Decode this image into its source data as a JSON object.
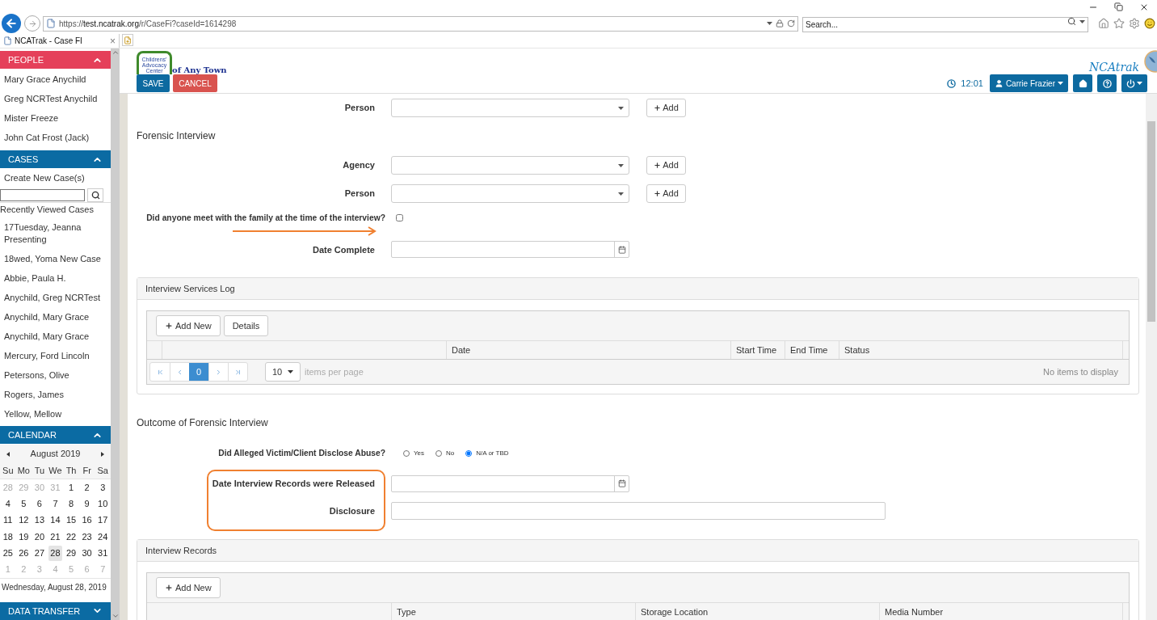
{
  "browser": {
    "url": {
      "scheme": "https://",
      "host": "test.ncatrak.org",
      "path": "/r/CaseFi?caseId=1614298"
    },
    "search": {
      "placeholder": "Search..."
    },
    "tabs": [
      {
        "title": "NCATrak - Case FI",
        "close": "×",
        "selected": true
      }
    ]
  },
  "sidebar": {
    "panels": [
      {
        "kind": "list",
        "title": "PEOPLE",
        "color": "#e5405a",
        "expanded": true,
        "items": [
          "Mary Grace Anychild",
          "Greg NCRTest Anychild",
          "Mister Freeze",
          "John Cat Frost (Jack)"
        ]
      },
      {
        "kind": "cases",
        "title": "CASES",
        "color": "#0b6ba3",
        "expanded": true,
        "create": "Create New Case(s)",
        "recent_title": "Recently Viewed Cases",
        "items": [
          "17Tuesday, Jeanna Presenting",
          "18wed, Yoma New Case",
          "Abbie, Paula H.",
          "Anychild, Greg NCRTest",
          "Anychild, Mary Grace",
          "Anychild, Mary Grace",
          "Mercury, Ford Lincoln",
          "Petersons, Olive",
          "Rogers, James",
          "Yellow, Mellow"
        ]
      },
      {
        "kind": "calendar",
        "title": "CALENDAR",
        "color": "#0b6ba3",
        "expanded": true,
        "month": "August 2019",
        "weekdays": [
          "Su",
          "Mo",
          "Tu",
          "We",
          "Th",
          "Fr",
          "Sa"
        ],
        "weeks": [
          [
            {
              "day": "28",
              "muted": true,
              "selected": false
            },
            {
              "day": "29",
              "muted": true,
              "selected": false
            },
            {
              "day": "30",
              "muted": true,
              "selected": false
            },
            {
              "day": "31",
              "muted": true,
              "selected": false
            },
            {
              "day": "1",
              "muted": false,
              "selected": false
            },
            {
              "day": "2",
              "muted": false,
              "selected": false
            },
            {
              "day": "3",
              "muted": false,
              "selected": false
            }
          ],
          [
            {
              "day": "4",
              "muted": false,
              "selected": false
            },
            {
              "day": "5",
              "muted": false,
              "selected": false
            },
            {
              "day": "6",
              "muted": false,
              "selected": false
            },
            {
              "day": "7",
              "muted": false,
              "selected": false
            },
            {
              "day": "8",
              "muted": false,
              "selected": false
            },
            {
              "day": "9",
              "muted": false,
              "selected": false
            },
            {
              "day": "10",
              "muted": false,
              "selected": false
            }
          ],
          [
            {
              "day": "11",
              "muted": false,
              "selected": false
            },
            {
              "day": "12",
              "muted": false,
              "selected": false
            },
            {
              "day": "13",
              "muted": false,
              "selected": false
            },
            {
              "day": "14",
              "muted": false,
              "selected": false
            },
            {
              "day": "15",
              "muted": false,
              "selected": false
            },
            {
              "day": "16",
              "muted": false,
              "selected": false
            },
            {
              "day": "17",
              "muted": false,
              "selected": false
            }
          ],
          [
            {
              "day": "18",
              "muted": false,
              "selected": false
            },
            {
              "day": "19",
              "muted": false,
              "selected": false
            },
            {
              "day": "20",
              "muted": false,
              "selected": false
            },
            {
              "day": "21",
              "muted": false,
              "selected": false
            },
            {
              "day": "22",
              "muted": false,
              "selected": false
            },
            {
              "day": "23",
              "muted": false,
              "selected": false
            },
            {
              "day": "24",
              "muted": false,
              "selected": false
            }
          ],
          [
            {
              "day": "25",
              "muted": false,
              "selected": false
            },
            {
              "day": "26",
              "muted": false,
              "selected": false
            },
            {
              "day": "27",
              "muted": false,
              "selected": false
            },
            {
              "day": "28",
              "muted": false,
              "selected": true
            },
            {
              "day": "29",
              "muted": false,
              "selected": false
            },
            {
              "day": "30",
              "muted": false,
              "selected": false
            },
            {
              "day": "31",
              "muted": false,
              "selected": false
            }
          ],
          [
            {
              "day": "1",
              "muted": true,
              "selected": false
            },
            {
              "day": "2",
              "muted": true,
              "selected": false
            },
            {
              "day": "3",
              "muted": true,
              "selected": false
            },
            {
              "day": "4",
              "muted": true,
              "selected": false
            },
            {
              "day": "5",
              "muted": true,
              "selected": false
            },
            {
              "day": "6",
              "muted": true,
              "selected": false
            },
            {
              "day": "7",
              "muted": true,
              "selected": false
            }
          ]
        ],
        "footer": "Wednesday, August 28, 2019"
      },
      {
        "title": "DATA TRANSFER",
        "color": "#0b6ba3",
        "expanded": false
      }
    ]
  },
  "header": {
    "logo": {
      "tagline": "Childrens' Advocacy Center",
      "town": "of Any Town"
    },
    "buttons": [
      {
        "label": "SAVE",
        "kind": "primary"
      },
      {
        "label": "CANCEL",
        "kind": "danger"
      }
    ],
    "brand": "NCAtrak",
    "time": "12:01",
    "user": "Carrie Frazier"
  },
  "form": [
    {
      "kind": "select_add",
      "label": "Person",
      "add": "Add"
    },
    {
      "kind": "heading",
      "text": "Forensic Interview"
    },
    {
      "kind": "select_add",
      "label": "Agency",
      "add": "Add"
    },
    {
      "kind": "select_add",
      "label": "Person",
      "add": "Add"
    },
    {
      "kind": "checkbox",
      "label": "Did anyone meet with the family at the time of the interview?",
      "checked": false
    },
    {
      "kind": "date",
      "label": "Date Complete",
      "annotated": true
    },
    {
      "kind": "grid",
      "title": "Interview Services Log",
      "toolbar": [
        {
          "label": "Add New",
          "plus": true
        },
        {
          "label": "Details",
          "plus": false
        }
      ],
      "columns": [
        {
          "kind": "blank"
        },
        {
          "kind": "blank"
        },
        {
          "kind": "label",
          "label": "Date"
        },
        {
          "kind": "label",
          "label": "Start Time"
        },
        {
          "kind": "label",
          "label": "End Time"
        },
        {
          "kind": "label",
          "label": "Status"
        }
      ],
      "pager": {
        "pages": [
          {
            "label": "0",
            "selected": true
          }
        ],
        "page_size": "10",
        "page_size_label": "items per page",
        "empty": "No items to display"
      }
    },
    {
      "kind": "heading",
      "text": "Outcome of Forensic Interview"
    },
    {
      "kind": "radio",
      "label": "Did Alleged Victim/Client Disclose Abuse?",
      "options": [
        {
          "label": "Yes",
          "selected": false
        },
        {
          "label": "No",
          "selected": false
        },
        {
          "label": "N/A or TBD",
          "selected": true
        }
      ]
    },
    {
      "kind": "group",
      "highlighted": true,
      "rows": [
        {
          "kind": "date",
          "label": "Date Interview Records were Released",
          "annotated": false
        },
        {
          "kind": "text",
          "label": "Disclosure"
        }
      ]
    },
    {
      "kind": "grid",
      "title": "Interview Records",
      "toolbar": [
        {
          "label": "Add New",
          "plus": true
        }
      ],
      "columns": [
        {
          "kind": "blank"
        },
        {
          "kind": "label",
          "label": "Type"
        },
        {
          "kind": "label",
          "label": "Storage Location"
        },
        {
          "kind": "label",
          "label": "Media Number"
        }
      ]
    }
  ]
}
